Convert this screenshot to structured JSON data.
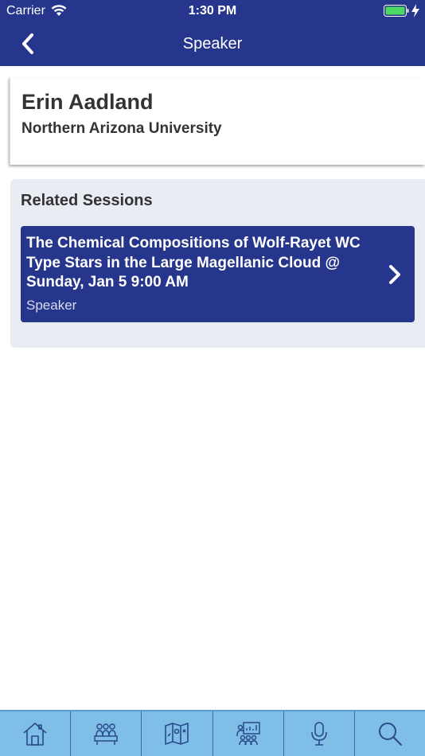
{
  "status_bar": {
    "carrier": "Carrier",
    "time": "1:30 PM"
  },
  "nav": {
    "title": "Speaker"
  },
  "speaker": {
    "name": "Erin Aadland",
    "affiliation": "Northern Arizona University"
  },
  "related": {
    "title": "Related Sessions",
    "sessions": [
      {
        "title": "The Chemical Compositions of Wolf-Rayet WC Type Stars in the Large Magellanic Cloud @ Sunday, Jan 5 9:00 AM",
        "role": "Speaker"
      }
    ]
  },
  "tabbar": {
    "icons": [
      "home-icon",
      "attendees-icon",
      "map-icon",
      "exhibitors-icon",
      "microphone-icon",
      "search-icon"
    ]
  },
  "colors": {
    "header": "#26368d",
    "session_card": "#26368d",
    "related_bg": "#e9ecf3",
    "tabbar": "#7fbee6",
    "icon": "#2a4a8a"
  }
}
